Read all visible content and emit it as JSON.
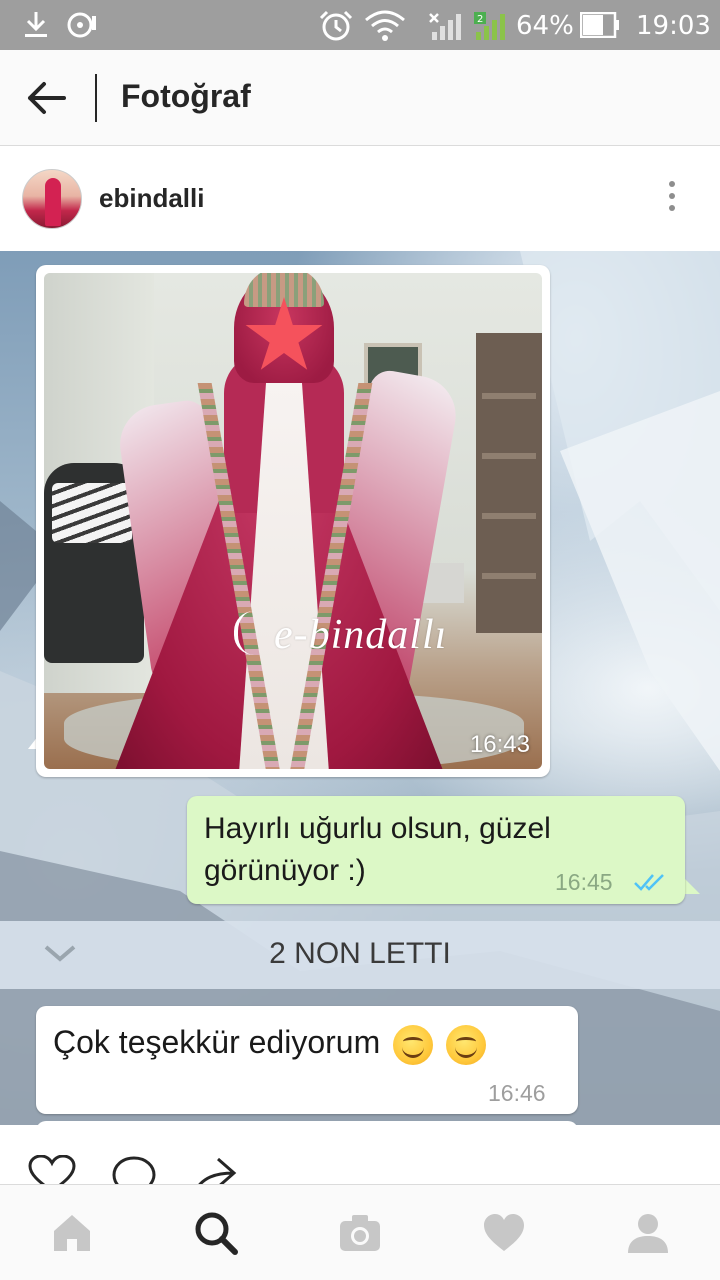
{
  "status_bar": {
    "battery_percent": "64%",
    "time": "19:03",
    "icons": [
      "download-icon",
      "media-icon",
      "alarm-icon",
      "wifi-icon",
      "no-sim-signal-icon",
      "signal-icon",
      "battery-icon"
    ]
  },
  "header": {
    "title": "Fotoğraf",
    "back_icon": "arrow-left-icon"
  },
  "post": {
    "username": "ebindalli",
    "more_icon": "more-vertical-icon",
    "image": {
      "description_elements": {
        "watermark": "e-bindallı"
      },
      "chat": {
        "photo_message": {
          "time": "16:43"
        },
        "outgoing_message": {
          "text": "Hayırlı uğurlu olsun, güzel görünüyor :)",
          "time": "16:45",
          "status_icon": "double-check-icon"
        },
        "unread_divider": "2 NON LETTI",
        "incoming_message": {
          "text": "Çok teşekkür ediyorum",
          "time": "16:46",
          "emoji_icons": [
            "smiling-face-icon",
            "smiling-face-icon"
          ]
        }
      }
    },
    "actions": [
      "heart-outline-icon",
      "comment-outline-icon",
      "share-arrow-icon"
    ]
  },
  "bottom_nav": {
    "items": [
      "home-icon",
      "search-icon",
      "camera-icon",
      "heart-icon",
      "profile-icon"
    ],
    "active": "search-icon"
  },
  "colors": {
    "outgoing_bubble": "#dcf8c6",
    "incoming_bubble": "#ffffff",
    "read_ticks": "#4fc3f7",
    "status_bar": "#9e9e9e",
    "censor_star": "#f5525c"
  }
}
